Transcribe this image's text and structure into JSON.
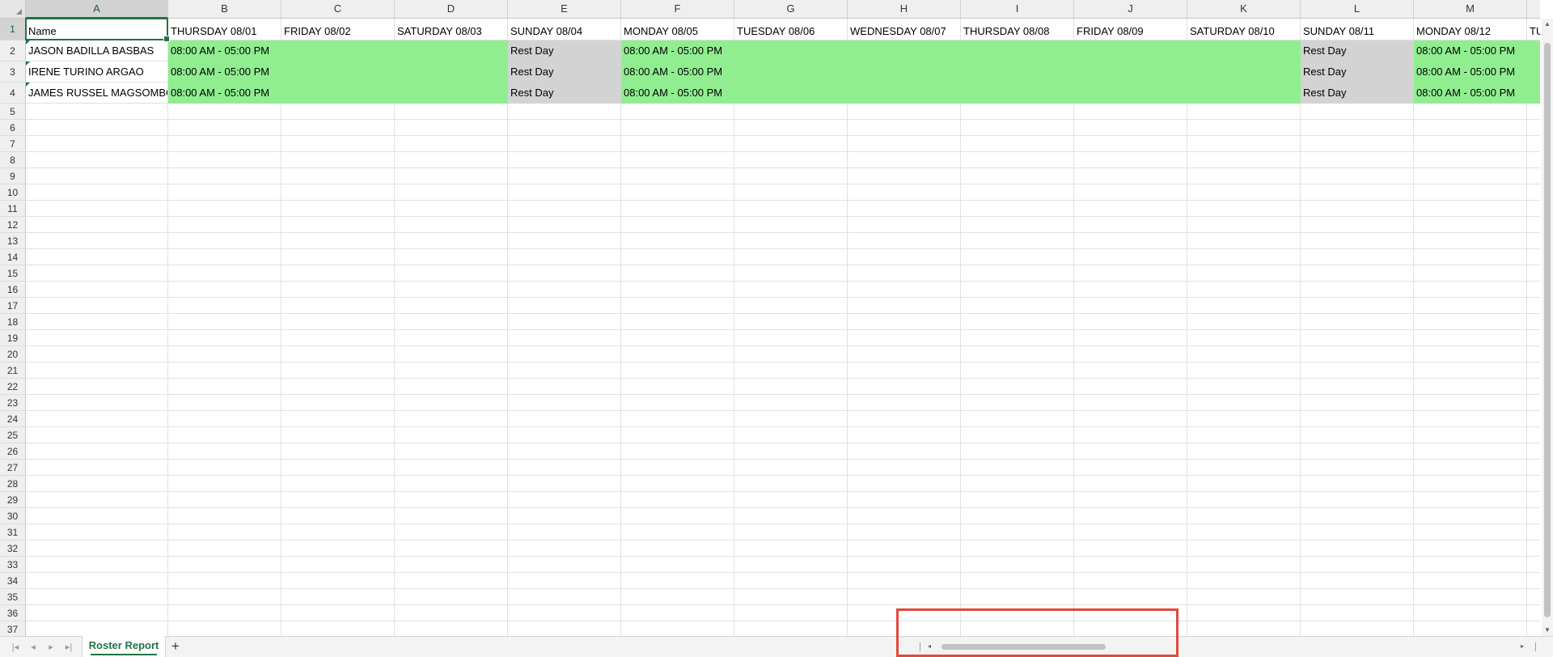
{
  "columns": [
    "A",
    "B",
    "C",
    "D",
    "E",
    "F",
    "G",
    "H",
    "I",
    "J",
    "K",
    "L",
    "M"
  ],
  "header_row": {
    "name_label": "Name",
    "days": [
      "THURSDAY 08/01",
      "FRIDAY 08/02",
      "SATURDAY 08/03",
      "SUNDAY 08/04",
      "MONDAY 08/05",
      "TUESDAY 08/06",
      "WEDNESDAY 08/07",
      "THURSDAY 08/08",
      "FRIDAY 08/09",
      "SATURDAY 08/10",
      "SUNDAY 08/11",
      "MONDAY 08/12"
    ],
    "partial_next": "TU"
  },
  "employees": [
    {
      "name": "JASON  BADILLA BASBAS"
    },
    {
      "name": "IRENE  TURINO ARGAO"
    },
    {
      "name": "JAMES RUSSEL MAGSOMBOL"
    }
  ],
  "shift_text": "08:00 AM - 05:00 PM",
  "rest_text": "Rest Day",
  "row_numbers": [
    "1",
    "2",
    "3",
    "4",
    "5",
    "6",
    "7",
    "8",
    "9",
    "10",
    "11",
    "12",
    "13",
    "14",
    "15",
    "16",
    "17",
    "18",
    "19",
    "20",
    "21",
    "22",
    "23",
    "24",
    "25",
    "26",
    "27",
    "28",
    "29",
    "30",
    "31",
    "32",
    "33",
    "34",
    "35",
    "36",
    "37"
  ],
  "sheet_tabs": [
    {
      "label": "Roster Report",
      "active": true
    }
  ],
  "icons": {
    "first": "first-sheet-icon",
    "prev": "prev-sheet-icon",
    "next": "next-sheet-icon",
    "last": "last-sheet-icon",
    "add": "add-sheet-icon"
  },
  "colors": {
    "shift": "#90ee90",
    "rest": "#d3d3d3",
    "accent": "#217346",
    "highlight": "#e1493b"
  }
}
